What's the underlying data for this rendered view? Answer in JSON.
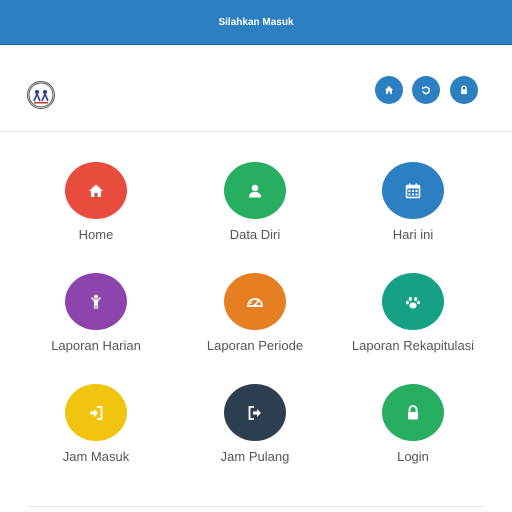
{
  "topbar": {
    "title": "Silahkan Masuk"
  },
  "header": {
    "buttons": [
      {
        "name": "home-button",
        "icon": "home-icon"
      },
      {
        "name": "refresh-button",
        "icon": "undo-icon"
      },
      {
        "name": "lock-button",
        "icon": "lock-icon"
      }
    ]
  },
  "menu": [
    {
      "label": "Home",
      "color": "#e74c3c",
      "icon": "home-icon"
    },
    {
      "label": "Data Diri",
      "color": "#27ae60",
      "icon": "user-icon"
    },
    {
      "label": "Hari ini",
      "color": "#2c7fc0",
      "icon": "calendar-icon"
    },
    {
      "label": "Laporan Harian",
      "color": "#8e44ad",
      "icon": "child-icon"
    },
    {
      "label": "Laporan Periode",
      "color": "#e67e22",
      "icon": "dashboard-icon"
    },
    {
      "label": "Laporan Rekapitulasi",
      "color": "#16a085",
      "icon": "paw-icon"
    },
    {
      "label": "Jam Masuk",
      "color": "#f1c40f",
      "icon": "sign-in-icon"
    },
    {
      "label": "Jam Pulang",
      "color": "#2c3e50",
      "icon": "sign-out-icon"
    },
    {
      "label": "Login",
      "color": "#27ae60",
      "icon": "lock-icon"
    }
  ],
  "colors": {
    "primary": "#2c7fc0"
  }
}
